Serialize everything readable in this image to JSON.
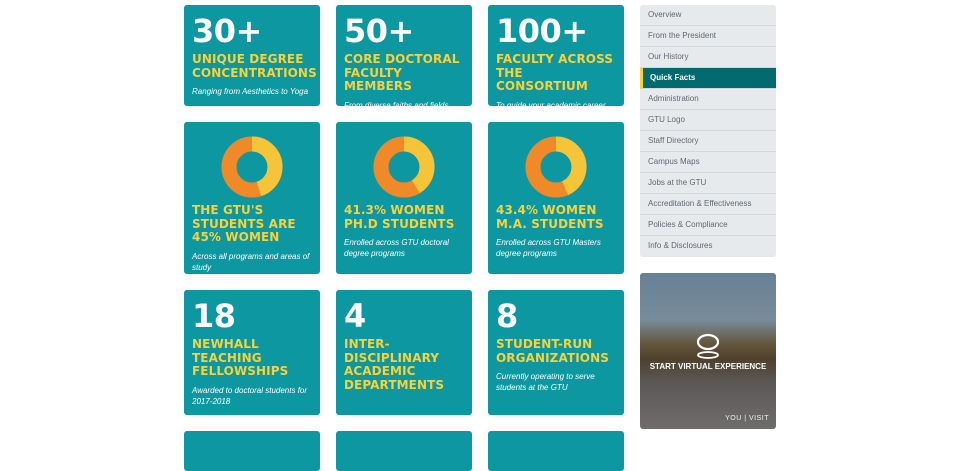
{
  "stats": [
    {
      "big": "30+",
      "head": "UNIQUE DEGREE CONCENTRATIONS",
      "desc": "Ranging from Aesthetics to Yoga"
    },
    {
      "big": "50+",
      "head": "CORE DOCTORAL FACULTY MEMBERS",
      "desc": "From diverse faiths and fields"
    },
    {
      "big": "100+",
      "head": "FACULTY ACROSS THE CONSORTIUM",
      "desc": "To guide your academic career"
    },
    {
      "head": "THE GTU'S STUDENTS ARE 45% WOMEN",
      "desc": "Across all programs and areas of study",
      "percent": 45
    },
    {
      "head": "41.3% WOMEN PH.D STUDENTS",
      "desc": "Enrolled across GTU doctoral degree programs",
      "percent": 41.3
    },
    {
      "head": "43.4% WOMEN M.A. STUDENTS",
      "desc": "Enrolled across GTU Masters degree programs",
      "percent": 43.4
    },
    {
      "big": "18",
      "head": "NEWHALL TEACHING FELLOWSHIPS",
      "desc": "Awarded to doctoral students for 2017-2018"
    },
    {
      "big": "4",
      "head": "INTER-DISCIPLINARY ACADEMIC DEPARTMENTS",
      "desc": ""
    },
    {
      "big": "8",
      "head": "STUDENT-RUN ORGANIZATIONS",
      "desc": "Currently operating to serve students at the GTU"
    }
  ],
  "colors": {
    "card": "#0d97a1",
    "accent": "#f7d23a",
    "donut_women": "#f5c438",
    "donut_rest": "#f08a28"
  },
  "sidebar": {
    "items": [
      {
        "label": "Overview"
      },
      {
        "label": "From the President"
      },
      {
        "label": "Our History"
      },
      {
        "label": "Quick Facts",
        "active": true
      },
      {
        "label": "Administration"
      },
      {
        "label": "GTU Logo"
      },
      {
        "label": "Staff Directory"
      },
      {
        "label": "Campus Maps"
      },
      {
        "label": "Jobs at the GTU"
      },
      {
        "label": "Accreditation & Effectiveness"
      },
      {
        "label": "Policies & Compliance"
      },
      {
        "label": "Info & Disclosures"
      }
    ]
  },
  "virtual_tour": {
    "label": "START VIRTUAL EXPERIENCE",
    "brand": "YOU | VISIT"
  }
}
